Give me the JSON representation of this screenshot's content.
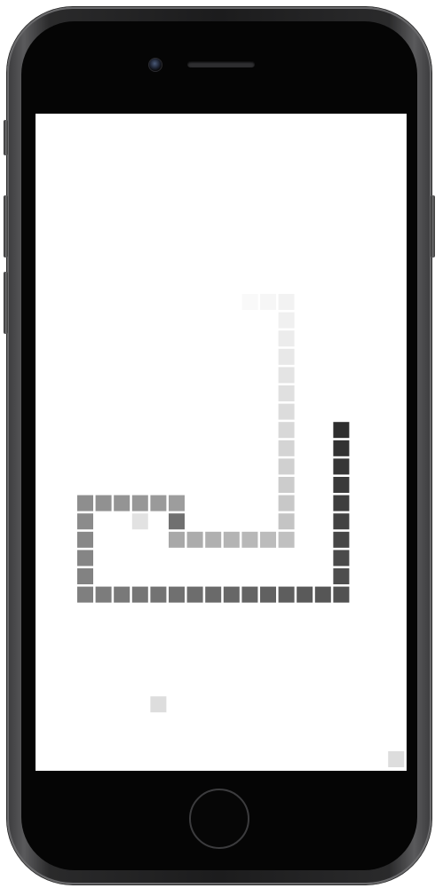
{
  "game": {
    "cell_unit": 20.5,
    "snake_cells": [
      [
        14,
        10,
        "#f9f9f9"
      ],
      [
        15,
        10,
        "#f6f6f6"
      ],
      [
        16,
        10,
        "#f2f2f2"
      ],
      [
        16,
        11,
        "#f0f0f0"
      ],
      [
        16,
        12,
        "#ececec"
      ],
      [
        16,
        13,
        "#e8e8e8"
      ],
      [
        16,
        14,
        "#e4e4e4"
      ],
      [
        16,
        15,
        "#e0e0e0"
      ],
      [
        16,
        16,
        "#dcdcdc"
      ],
      [
        16,
        17,
        "#d8d8d8"
      ],
      [
        16,
        18,
        "#d4d4d4"
      ],
      [
        16,
        19,
        "#d0d0d0"
      ],
      [
        16,
        20,
        "#cccccc"
      ],
      [
        16,
        21,
        "#c8c8c8"
      ],
      [
        16,
        22,
        "#c4c4c4"
      ],
      [
        16,
        23,
        "#c0c0c0"
      ],
      [
        15,
        23,
        "#bcbcbc"
      ],
      [
        14,
        23,
        "#b8b8b8"
      ],
      [
        13,
        23,
        "#b4b4b4"
      ],
      [
        12,
        23,
        "#b0b0b0"
      ],
      [
        11,
        23,
        "#acacac"
      ],
      [
        10,
        23,
        "#a8a8a8"
      ],
      [
        10,
        22,
        "#707070"
      ],
      [
        10,
        21,
        "#9d9d9d"
      ],
      [
        9,
        21,
        "#9a9a9a"
      ],
      [
        8,
        21,
        "#979797"
      ],
      [
        7,
        21,
        "#949494"
      ],
      [
        6,
        21,
        "#919191"
      ],
      [
        5,
        21,
        "#8e8e8e"
      ],
      [
        5,
        22,
        "#8b8b8b"
      ],
      [
        5,
        23,
        "#888888"
      ],
      [
        5,
        24,
        "#858585"
      ],
      [
        5,
        25,
        "#828282"
      ],
      [
        5,
        26,
        "#7f7f7f"
      ],
      [
        6,
        26,
        "#7c7c7c"
      ],
      [
        7,
        26,
        "#797979"
      ],
      [
        8,
        26,
        "#767676"
      ],
      [
        9,
        26,
        "#737373"
      ],
      [
        10,
        26,
        "#707070"
      ],
      [
        11,
        26,
        "#6d6d6d"
      ],
      [
        12,
        26,
        "#6a6a6a"
      ],
      [
        13,
        26,
        "#676767"
      ],
      [
        14,
        26,
        "#646464"
      ],
      [
        15,
        26,
        "#616161"
      ],
      [
        16,
        26,
        "#5e5e5e"
      ],
      [
        17,
        26,
        "#5a5a5a"
      ],
      [
        18,
        26,
        "#565656"
      ],
      [
        19,
        26,
        "#525252"
      ],
      [
        19,
        25,
        "#4e4e4e"
      ],
      [
        19,
        24,
        "#4a4a4a"
      ],
      [
        19,
        23,
        "#464646"
      ],
      [
        19,
        22,
        "#424242"
      ],
      [
        19,
        21,
        "#3e3e3e"
      ],
      [
        19,
        20,
        "#3a3a3a"
      ],
      [
        19,
        19,
        "#363636"
      ],
      [
        19,
        18,
        "#323232"
      ],
      [
        19,
        17,
        "#2e2e2e"
      ]
    ],
    "items": [
      {
        "col": 8,
        "row": 22,
        "color": "#e2e2e2"
      },
      {
        "col": 9,
        "row": 32,
        "color": "#dddddd"
      },
      {
        "col": 22,
        "row": 35,
        "color": "#dddddd"
      }
    ]
  }
}
